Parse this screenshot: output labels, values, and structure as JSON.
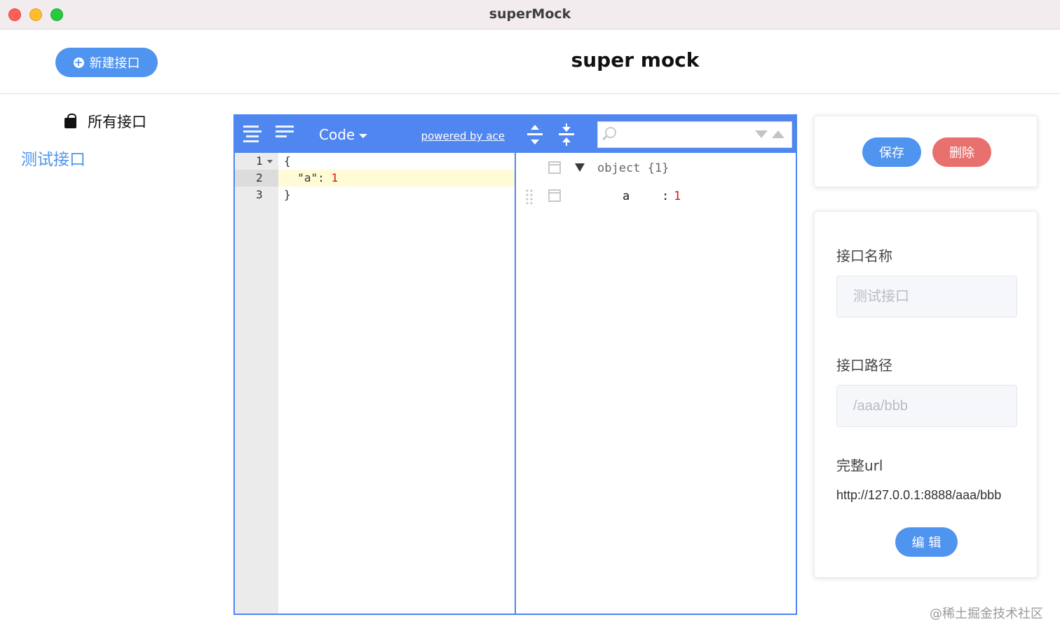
{
  "window": {
    "title": "superMock"
  },
  "header": {
    "new_button": "新建接口",
    "app_title": "super mock"
  },
  "sidebar": {
    "all_label": "所有接口",
    "items": [
      {
        "label": "测试接口"
      }
    ]
  },
  "editor": {
    "mode": "Code",
    "powered_by": "powered by ace",
    "line_numbers": [
      "1",
      "2",
      "3"
    ],
    "code_lines": [
      {
        "text": "{"
      },
      {
        "indent": "  ",
        "key": "\"a\"",
        "sep": ": ",
        "value": "1"
      },
      {
        "text": "}"
      }
    ],
    "tree": {
      "root_label": "object {1}",
      "nodes": [
        {
          "key": "a",
          "sep": ":",
          "value": "1"
        }
      ]
    },
    "search": {
      "placeholder": ""
    }
  },
  "actions": {
    "save": "保存",
    "delete": "删除"
  },
  "form": {
    "name_label": "接口名称",
    "name_value": "测试接口",
    "path_label": "接口路径",
    "path_value": "/aaa/bbb",
    "url_label": "完整url",
    "url_value": "http://127.0.0.1:8888/aaa/bbb",
    "edit_button": "编 辑"
  },
  "watermark": "@稀土掘金技术社区",
  "colors": {
    "primary": "#4f94ef",
    "danger": "#e8706e",
    "ace_bar": "#4f86f0"
  },
  "icons": [
    "plus-circle-icon",
    "shopping-bag-icon",
    "format-icon",
    "compact-icon",
    "caret-down-icon",
    "expand-all-icon",
    "collapse-all-icon",
    "search-icon",
    "search-next-icon",
    "search-prev-icon",
    "checkbox-icon",
    "drag-handle-icon",
    "expand-triangle-icon"
  ]
}
